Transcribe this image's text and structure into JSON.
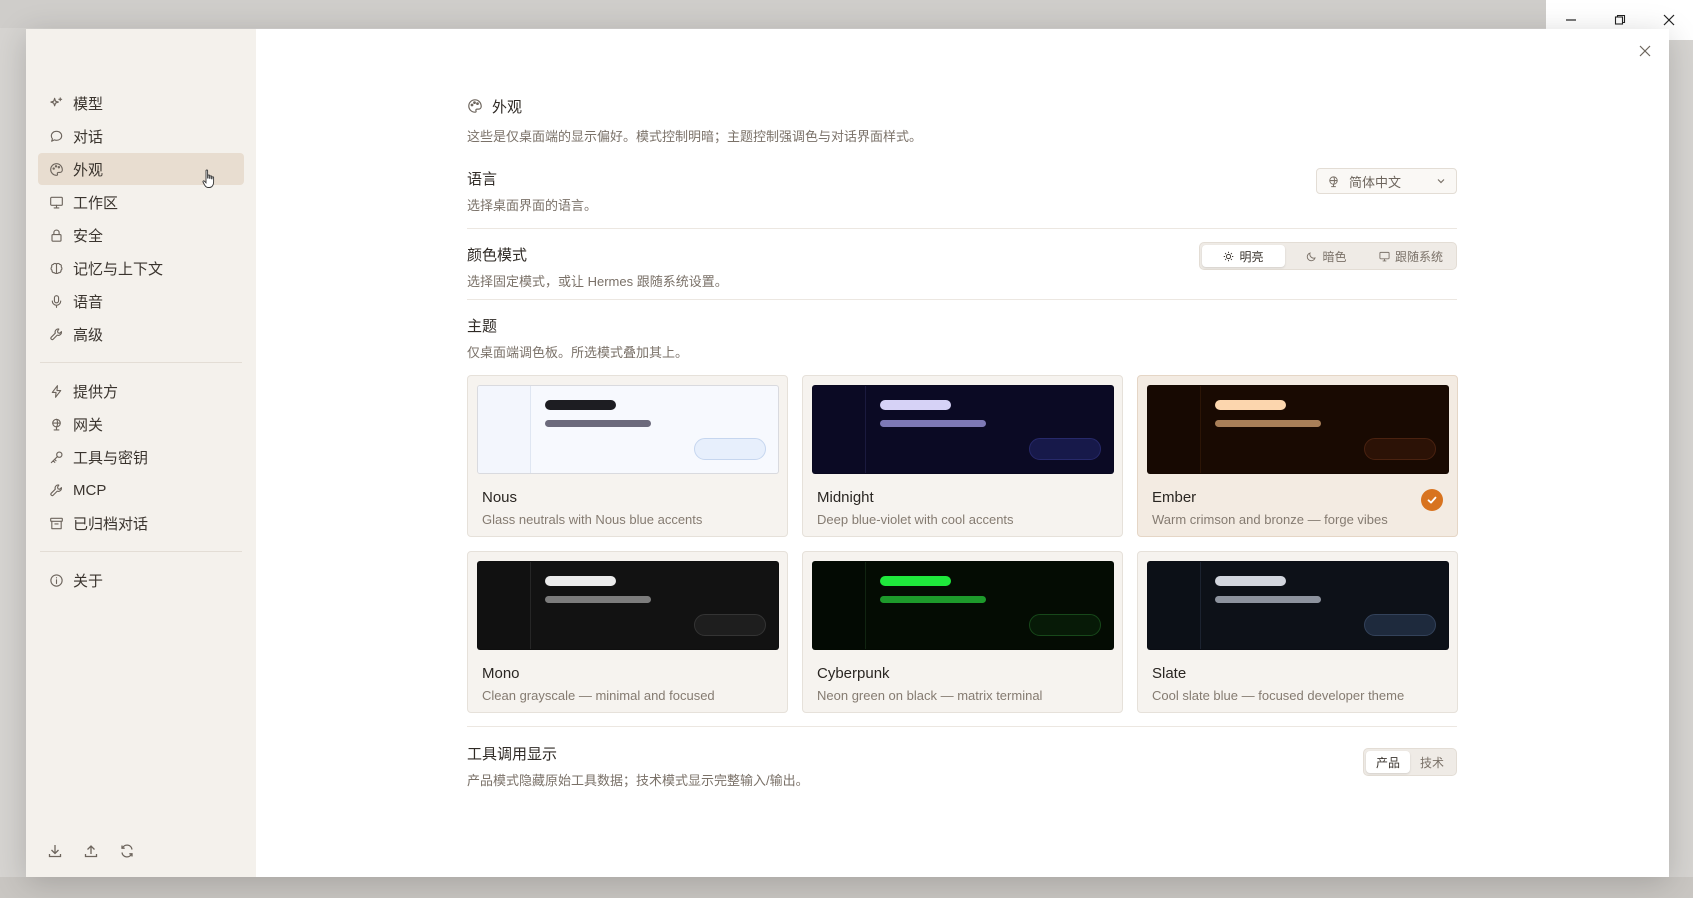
{
  "sidebar": {
    "items": [
      {
        "label": "模型",
        "icon": "sparkle-icon"
      },
      {
        "label": "对话",
        "icon": "chat-icon"
      },
      {
        "label": "外观",
        "icon": "palette-icon",
        "active": true
      },
      {
        "label": "工作区",
        "icon": "monitor-icon"
      },
      {
        "label": "安全",
        "icon": "lock-icon"
      },
      {
        "label": "记忆与上下文",
        "icon": "brain-icon"
      },
      {
        "label": "语音",
        "icon": "microphone-icon"
      },
      {
        "label": "高级",
        "icon": "wrench-icon"
      }
    ],
    "items2": [
      {
        "label": "提供方",
        "icon": "bolt-icon"
      },
      {
        "label": "网关",
        "icon": "gateway-icon"
      },
      {
        "label": "工具与密钥",
        "icon": "key-icon"
      },
      {
        "label": "MCP",
        "icon": "wrench-icon"
      },
      {
        "label": "已归档对话",
        "icon": "archive-icon"
      }
    ],
    "items3": [
      {
        "label": "关于",
        "icon": "info-icon"
      }
    ]
  },
  "appearance": {
    "title": "外观",
    "desc": "这些是仅桌面端的显示偏好。模式控制明暗；主题控制强调色与对话界面样式。"
  },
  "language": {
    "label": "语言",
    "desc": "选择桌面界面的语言。",
    "value": "简体中文"
  },
  "color_mode": {
    "label": "颜色模式",
    "desc": "选择固定模式，或让 Hermes 跟随系统设置。",
    "options": [
      "明亮",
      "暗色",
      "跟随系统"
    ],
    "selected": "明亮"
  },
  "theme": {
    "label": "主题",
    "desc": "仅桌面端调色板。所选模式叠加其上。",
    "selected": "Ember",
    "themes": [
      {
        "name": "Nous",
        "desc": "Glass neutrals with Nous blue accents",
        "colors": {
          "bg": "#f7f9fe",
          "side": "#f3f6fd",
          "line": "#dfe6f2",
          "bar1": "#1d1d22",
          "bar2": "#6c6a7c",
          "pill": "#e7effc",
          "pill_border": "#c6d6ef"
        }
      },
      {
        "name": "Midnight",
        "desc": "Deep blue-violet with cool accents",
        "colors": {
          "bg": "#0b0a24",
          "side": "#0b0a24",
          "line": "#1b1a3e",
          "bar1": "#d6d2f6",
          "bar2": "#7e79b6",
          "pill": "#17194a",
          "pill_border": "#27296a"
        }
      },
      {
        "name": "Ember",
        "desc": "Warm crimson and bronze — forge vibes",
        "colors": {
          "bg": "#190a02",
          "side": "#170902",
          "line": "#2c1506",
          "bar1": "#fcd6ae",
          "bar2": "#a97f58",
          "pill": "#2c1206",
          "pill_border": "#4a2210"
        }
      },
      {
        "name": "Mono",
        "desc": "Clean grayscale — minimal and focused",
        "colors": {
          "bg": "#121212",
          "side": "#111111",
          "line": "#262626",
          "bar1": "#ececec",
          "bar2": "#7c7c7c",
          "pill": "#1e1e1e",
          "pill_border": "#343434"
        }
      },
      {
        "name": "Cyberpunk",
        "desc": "Neon green on black — matrix terminal",
        "colors": {
          "bg": "#040c03",
          "side": "#030a03",
          "line": "#112411",
          "bar1": "#1fe83c",
          "bar2": "#1d9a2b",
          "pill": "#071a07",
          "pill_border": "#17481a"
        }
      },
      {
        "name": "Slate",
        "desc": "Cool slate blue — focused developer theme",
        "colors": {
          "bg": "#0d1118",
          "side": "#0c1017",
          "line": "#1c2330",
          "bar1": "#d2d6de",
          "bar2": "#8d939e",
          "pill": "#1e2a3d",
          "pill_border": "#33425a"
        }
      }
    ]
  },
  "tool_display": {
    "label": "工具调用显示",
    "desc": "产品模式隐藏原始工具数据；技术模式显示完整输入/输出。",
    "options": [
      "产品",
      "技术"
    ],
    "selected": "产品"
  },
  "accent": "#d8731f"
}
